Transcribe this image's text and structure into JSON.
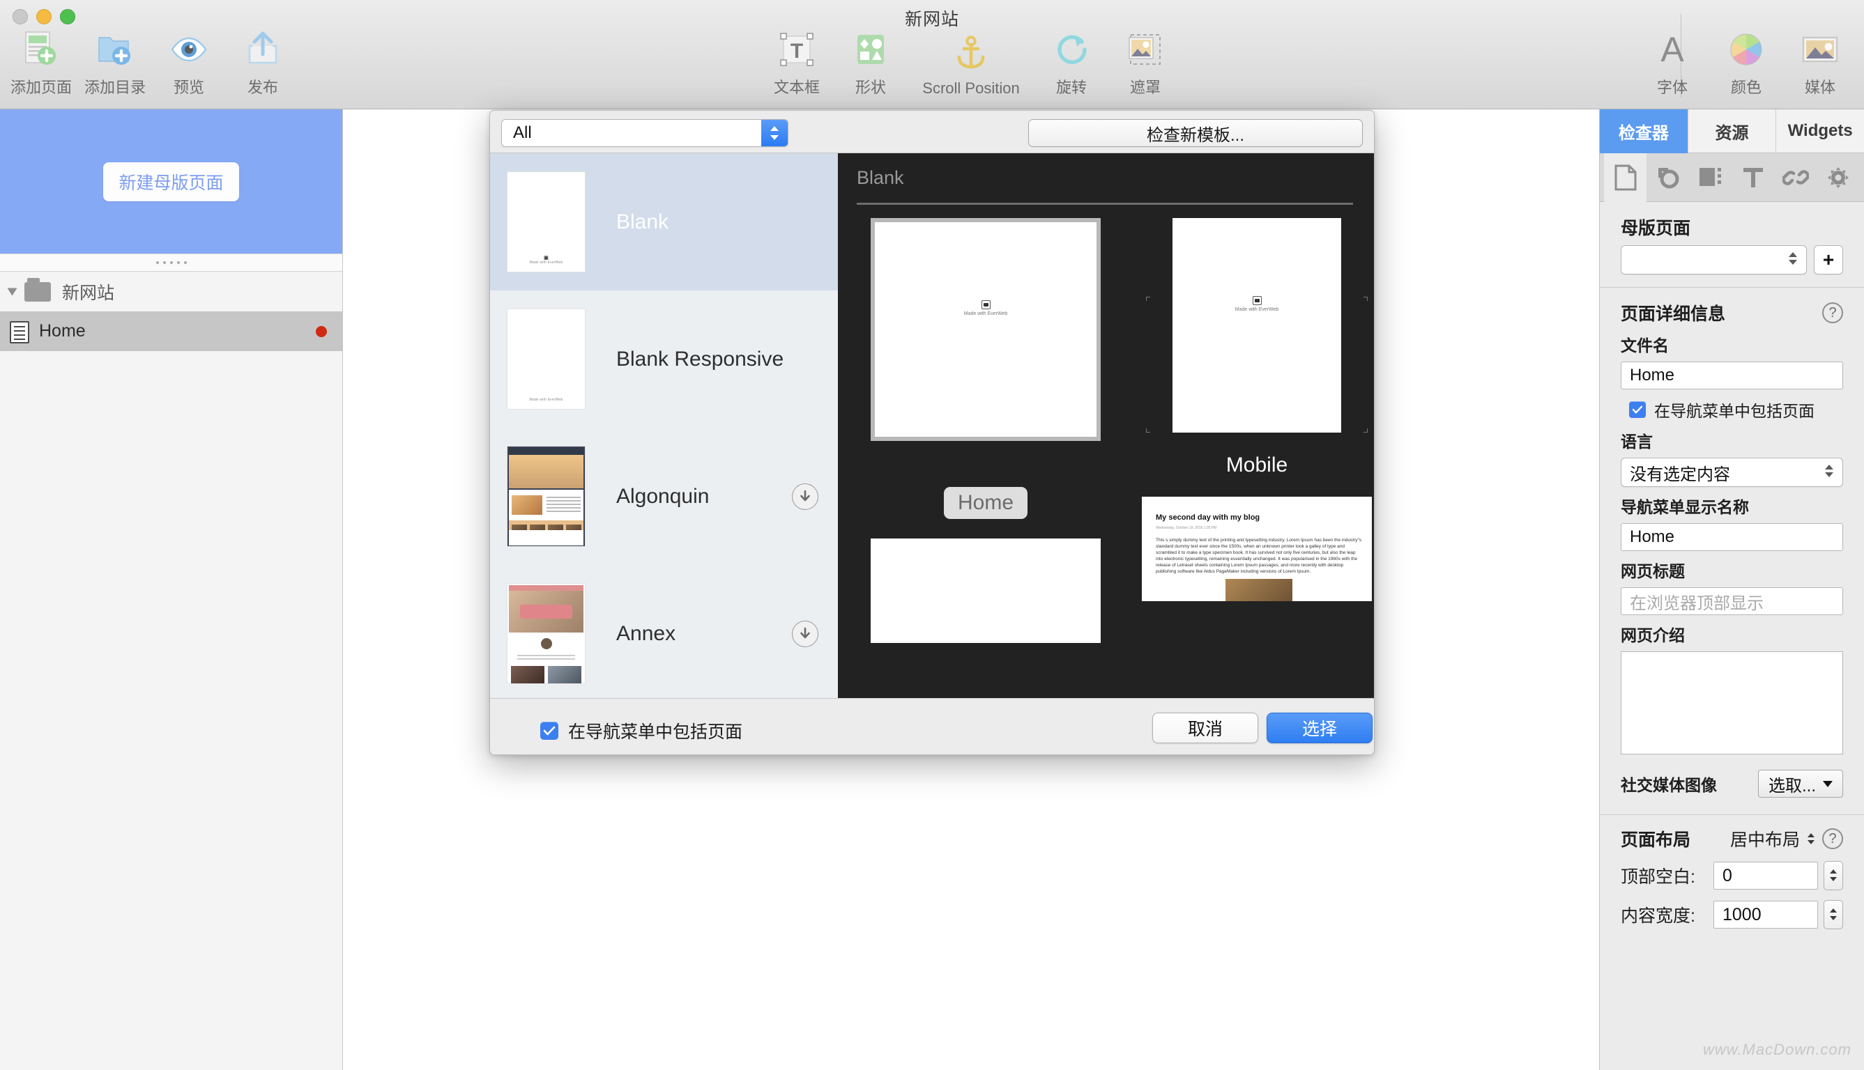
{
  "window": {
    "title": "新网站"
  },
  "toolbar": {
    "left_items": [
      {
        "label": "添加页面",
        "icon": "add-page-icon"
      },
      {
        "label": "添加目录",
        "icon": "add-folder-icon"
      },
      {
        "label": "预览",
        "icon": "preview-eye-icon"
      },
      {
        "label": "发布",
        "icon": "publish-upload-icon"
      }
    ],
    "center_items": [
      {
        "label": "文本框",
        "icon": "text-box-icon"
      },
      {
        "label": "形状",
        "icon": "shapes-icon"
      },
      {
        "label": "Scroll Position",
        "icon": "anchor-icon"
      },
      {
        "label": "旋转",
        "icon": "rotate-icon"
      },
      {
        "label": "遮罩",
        "icon": "mask-icon"
      }
    ],
    "right_items": [
      {
        "label": "字体",
        "icon": "font-a-icon"
      },
      {
        "label": "颜色",
        "icon": "color-wheel-icon"
      },
      {
        "label": "媒体",
        "icon": "media-image-icon"
      }
    ]
  },
  "sidebar": {
    "master_button": "新建母版页面",
    "tree": [
      {
        "label": "新网站",
        "type": "site"
      },
      {
        "label": "Home",
        "type": "page",
        "modified": true
      }
    ]
  },
  "dialog": {
    "filter": {
      "value": "All"
    },
    "check_templates_button": "检查新模板...",
    "templates": [
      {
        "name": "Blank",
        "selected": true,
        "downloadable": false,
        "thumb": "blank",
        "thumb_caption": "Made with EverWeb"
      },
      {
        "name": "Blank Responsive",
        "selected": false,
        "downloadable": false,
        "thumb": "blank",
        "thumb_caption": "Made with EverWeb"
      },
      {
        "name": "Algonquin",
        "selected": false,
        "downloadable": true,
        "thumb": "algonquin"
      },
      {
        "name": "Annex",
        "selected": false,
        "downloadable": true,
        "thumb": "annex"
      }
    ],
    "preview": {
      "title": "Blank",
      "columns": [
        {
          "label": "Home",
          "selected": true,
          "caption": "Made with EverWeb"
        },
        {
          "label": "Mobile",
          "selected": false,
          "caption": "Made with EverWeb"
        }
      ],
      "blog": {
        "title": "My second day with my blog",
        "date": "Wednesday, October 19, 2016 1:35 PM",
        "body": "This s simply dummy text of the printing and typesetting industry. Lorem Ipsum has been the industry\"s standard dummy text ever since the 1500s, when an unknown printer took a galley of type and scrambled it to make a type specimen book. It has survived not only five centuries, but also the leap into electronic typesetting, remaining essentially unchanged. It was popularised in the 1960s with the release of Letraset sheets containing Lorem Ipsum passages, and more recently with desktop publishing software like Aldus PageMaker including versions of Lorem Ipsum."
      }
    },
    "footer": {
      "checkbox_label": "在导航菜单中包括页面",
      "checkbox_checked": true,
      "cancel_label": "取消",
      "choose_label": "选择"
    }
  },
  "inspector": {
    "tabs": [
      {
        "label": "检查器",
        "active": true
      },
      {
        "label": "资源",
        "active": false
      },
      {
        "label": "Widgets",
        "active": false
      }
    ],
    "icon_tabs": [
      {
        "icon": "page-doc-icon",
        "active": true
      },
      {
        "icon": "shape-circle-icon",
        "active": false
      },
      {
        "icon": "metrics-icon",
        "active": false
      },
      {
        "icon": "text-t-icon",
        "active": false
      },
      {
        "icon": "link-chain-icon",
        "active": false
      },
      {
        "icon": "gear-icon",
        "active": false
      }
    ],
    "master_page": {
      "title": "母版页面",
      "value": "",
      "add_label": "+"
    },
    "page_details": {
      "title": "页面详细信息",
      "filename_label": "文件名",
      "filename_value": "Home",
      "include_nav_label": "在导航菜单中包括页面",
      "include_nav_checked": true,
      "language_label": "语言",
      "language_value": "没有选定内容",
      "nav_display_label": "导航菜单显示名称",
      "nav_display_value": "Home",
      "page_title_label": "网页标题",
      "page_title_placeholder": "在浏览器顶部显示",
      "page_title_value": "",
      "page_desc_label": "网页介绍",
      "page_desc_value": "",
      "social_image_label": "社交媒体图像",
      "social_image_button": "选取..."
    },
    "page_layout": {
      "title": "页面布局",
      "alignment_value": "居中布局",
      "top_margin_label": "顶部空白:",
      "top_margin_value": "0",
      "content_width_label": "内容宽度:",
      "content_width_value": "1000"
    }
  },
  "watermark": "www.MacDown.com",
  "colors": {
    "accent_blue": "#3d7ff0",
    "master_banner": "#85a9f5",
    "preview_bg": "#222222",
    "selection_blue": "#d2dcea"
  }
}
